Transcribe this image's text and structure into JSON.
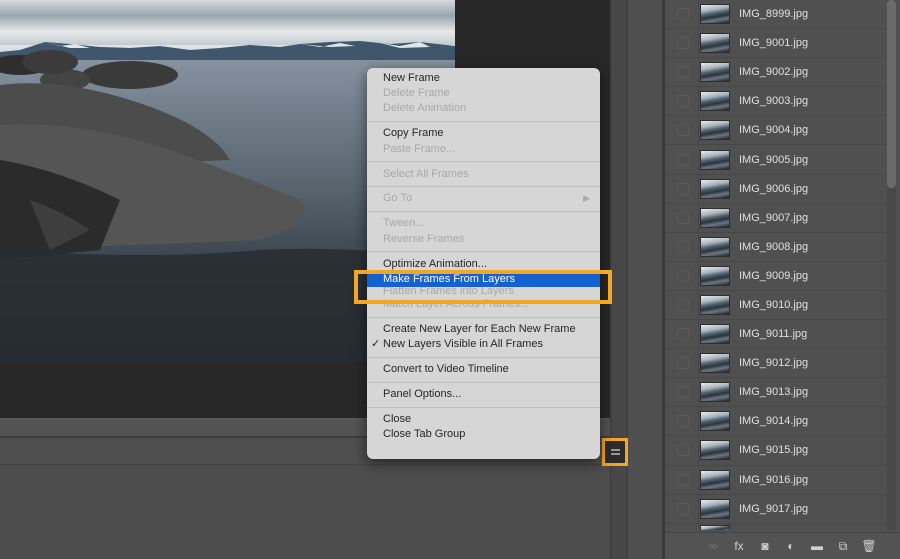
{
  "app": "Photoshop",
  "canvas": {
    "image_description": "Lake with large granite boulders in foreground, snowy mountains under cloudy sky"
  },
  "context_menu": {
    "groups": [
      [
        {
          "label": "New Frame",
          "enabled": true
        },
        {
          "label": "Delete Frame",
          "enabled": false
        },
        {
          "label": "Delete Animation",
          "enabled": false
        }
      ],
      [
        {
          "label": "Copy Frame",
          "enabled": true
        },
        {
          "label": "Paste Frame...",
          "enabled": false
        }
      ],
      [
        {
          "label": "Select All Frames",
          "enabled": false
        }
      ],
      [
        {
          "label": "Go To",
          "enabled": false,
          "submenu": true
        }
      ],
      [
        {
          "label": "Tween...",
          "enabled": false
        },
        {
          "label": "Reverse Frames",
          "enabled": false
        }
      ],
      [
        {
          "label": "Optimize Animation...",
          "enabled": true
        },
        {
          "label": "Make Frames From Layers",
          "enabled": true,
          "highlighted": true
        },
        {
          "label": "Flatten Frames into Layers",
          "enabled": false,
          "obscured": true
        },
        {
          "label": "Match Layer Across Frames...",
          "enabled": false
        }
      ],
      [
        {
          "label": "Create New Layer for Each New Frame",
          "enabled": true
        },
        {
          "label": "New Layers Visible in All Frames",
          "enabled": true,
          "checked": true
        }
      ],
      [
        {
          "label": "Convert to Video Timeline",
          "enabled": true
        }
      ],
      [
        {
          "label": "Panel Options...",
          "enabled": true
        }
      ],
      [
        {
          "label": "Close",
          "enabled": true
        },
        {
          "label": "Close Tab Group",
          "enabled": true
        }
      ]
    ],
    "submenu_arrow": "▶",
    "check_mark": "✓"
  },
  "annotation": {
    "highlight_color": "#f5a623",
    "highlighted_item": "Make Frames From Layers",
    "highlighted_button": "panel-menu-button"
  },
  "layers_panel": {
    "layers": [
      "IMG_8999.jpg",
      "IMG_9001.jpg",
      "IMG_9002.jpg",
      "IMG_9003.jpg",
      "IMG_9004.jpg",
      "IMG_9005.jpg",
      "IMG_9006.jpg",
      "IMG_9007.jpg",
      "IMG_9008.jpg",
      "IMG_9009.jpg",
      "IMG_9010.jpg",
      "IMG_9011.jpg",
      "IMG_9012.jpg",
      "IMG_9013.jpg",
      "IMG_9014.jpg",
      "IMG_9015.jpg",
      "IMG_9016.jpg",
      "IMG_9017.jpg"
    ],
    "footer_icons": [
      {
        "name": "link-layers-icon",
        "glyph": "∞",
        "dim": true
      },
      {
        "name": "fx-icon",
        "glyph": "fx",
        "dim": false
      },
      {
        "name": "layer-mask-icon",
        "glyph": "◙",
        "dim": false
      },
      {
        "name": "adjustment-layer-icon",
        "glyph": "◐",
        "dim": false
      },
      {
        "name": "new-group-icon",
        "glyph": "▬",
        "dim": false
      },
      {
        "name": "new-layer-icon",
        "glyph": "⧉",
        "dim": false
      },
      {
        "name": "delete-layer-icon",
        "glyph": "🗑",
        "dim": false
      }
    ]
  },
  "colors": {
    "menu_highlight": "#1561d0",
    "annotation": "#f5a623"
  }
}
